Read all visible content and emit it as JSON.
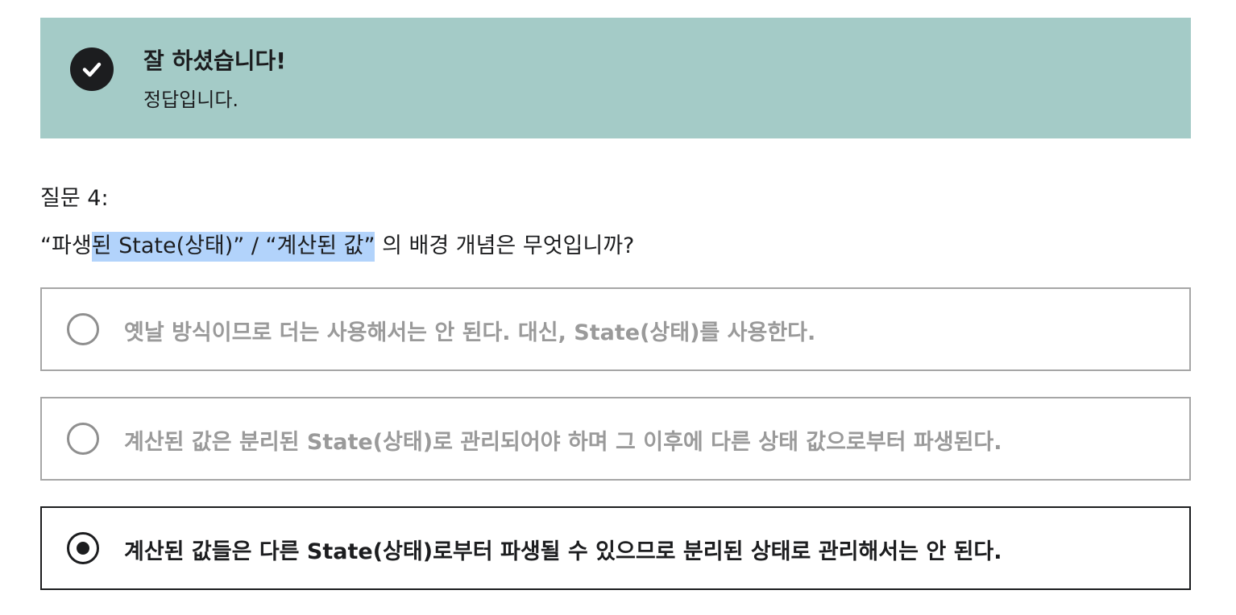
{
  "alert": {
    "icon": "check-circle-icon",
    "title": "잘 하셨습니다!",
    "subtitle": "정답입니다.",
    "background_color": "#a4cbc7"
  },
  "question": {
    "number_label": "질문 4:",
    "text_before": "“파생",
    "text_highlighted": "된 State(상태)” / “계산된 값”",
    "text_after": " 의 배경 개념은 무엇입니까?"
  },
  "options": [
    {
      "label": "옛날 방식이므로 더는 사용해서는 안 된다. 대신, State(상태)를 사용한다.",
      "selected": false
    },
    {
      "label": "계산된 값은 분리된 State(상태)로 관리되어야 하며 그 이후에 다른 상태 값으로부터 파생된다.",
      "selected": false
    },
    {
      "label": "계산된 값들은 다른 State(상태)로부터 파생될 수 있으므로 분리된 상태로 관리해서는 안 된다.",
      "selected": true
    }
  ]
}
